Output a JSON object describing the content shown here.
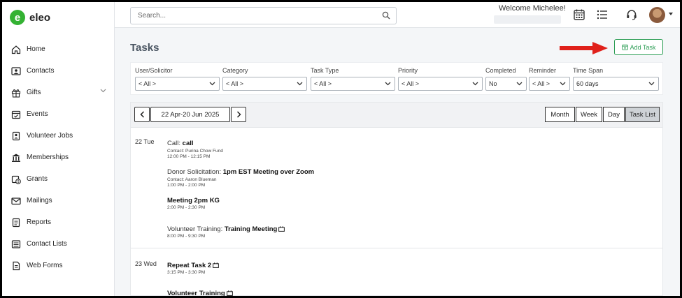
{
  "app": {
    "logo_letter": "e",
    "logo_text": "eleo",
    "brand_color": "#34b233"
  },
  "sidebar": {
    "items": [
      {
        "label": "Home",
        "icon": "home-icon"
      },
      {
        "label": "Contacts",
        "icon": "contacts-icon"
      },
      {
        "label": "Gifts",
        "icon": "gift-icon",
        "expandable": true
      },
      {
        "label": "Events",
        "icon": "events-icon"
      },
      {
        "label": "Volunteer Jobs",
        "icon": "volunteer-icon"
      },
      {
        "label": "Memberships",
        "icon": "memberships-icon"
      },
      {
        "label": "Grants",
        "icon": "grants-icon"
      },
      {
        "label": "Mailings",
        "icon": "mail-icon"
      },
      {
        "label": "Reports",
        "icon": "reports-icon"
      },
      {
        "label": "Contact Lists",
        "icon": "list-icon"
      },
      {
        "label": "Web Forms",
        "icon": "form-icon"
      }
    ]
  },
  "topbar": {
    "search_placeholder": "Search...",
    "welcome": "Welcome Michelee!",
    "icons": [
      "calendar-icon",
      "list-view-icon",
      "headset-icon"
    ]
  },
  "page": {
    "title": "Tasks",
    "add_task_label": "Add Task",
    "accent": "#2e9e56",
    "arrow_color": "#e0211b"
  },
  "filters": [
    {
      "label": "User/Solicitor",
      "value": "< All >"
    },
    {
      "label": "Category",
      "value": "< All >"
    },
    {
      "label": "Task Type",
      "value": "< All >"
    },
    {
      "label": "Priority",
      "value": "< All >"
    },
    {
      "label": "Completed",
      "value": "No"
    },
    {
      "label": "Reminder",
      "value": "< All >"
    },
    {
      "label": "Time Span",
      "value": "60 days"
    }
  ],
  "calendar": {
    "range": "22 Apr-20 Jun 2025",
    "views": [
      "Month",
      "Week",
      "Day",
      "Task List"
    ],
    "active_view": "Task List",
    "days": [
      {
        "label": "22 Tue",
        "tasks": [
          {
            "type": "Call: ",
            "title": "call",
            "sub": "Contact: Purina Chow Fund",
            "time": "12:00 PM - 12:15 PM",
            "repeat": false
          },
          {
            "type": "Donor Solicitation: ",
            "title": "1pm EST Meeting over Zoom",
            "sub": "Contact: Aaron Blueman",
            "time": "1:00 PM - 2:00 PM",
            "repeat": false
          },
          {
            "type": "",
            "title": "Meeting 2pm KG",
            "sub": "",
            "time": "2:00 PM - 2:30 PM",
            "repeat": false
          },
          {
            "type": "Volunteer Training: ",
            "title": "Training Meeting",
            "sub": "",
            "time": "8:00 PM - 9:30 PM",
            "repeat": true
          }
        ]
      },
      {
        "label": "23 Wed",
        "tasks": [
          {
            "type": "",
            "title": "Repeat Task 2",
            "sub": "",
            "time": "3:15 PM - 3:30 PM",
            "repeat": true
          },
          {
            "type": "",
            "title": "Volunteer Training",
            "sub": "",
            "time": "",
            "repeat": true
          }
        ]
      }
    ]
  }
}
